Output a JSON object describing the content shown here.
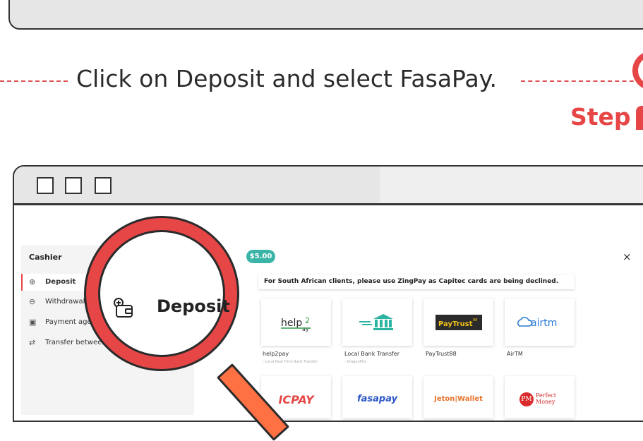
{
  "instruction": {
    "text": "Click on Deposit and select FasaPay.",
    "step_label": "Step"
  },
  "cashier": {
    "title": "Cashier",
    "menu": [
      {
        "label": "Deposit",
        "icon": "deposit-icon",
        "active": true
      },
      {
        "label": "Withdrawal",
        "icon": "withdrawal-icon",
        "active": false
      },
      {
        "label": "Payment agen",
        "icon": "payment-agent-icon",
        "active": false
      },
      {
        "label": "Transfer between",
        "icon": "transfer-icon",
        "active": false
      }
    ]
  },
  "header": {
    "balance": "$5.00",
    "close": "×"
  },
  "notice": "For South African clients, please use ZingPay as Capitec cards are being declined.",
  "payment_methods": [
    {
      "name": "help2pay",
      "sub": "- Local Real Time Bank Transfer",
      "logo": "help2pay"
    },
    {
      "name": "Local Bank Transfer",
      "sub": "- DragonPhx",
      "logo": "bank"
    },
    {
      "name": "PayTrust88",
      "sub": "",
      "logo": "paytrust"
    },
    {
      "name": "AirTM",
      "sub": "",
      "logo": "airtm"
    }
  ],
  "payment_methods_row2": [
    {
      "logo_text": "ICPAY"
    },
    {
      "logo_text": "fasapay"
    },
    {
      "logo_text": "Jeton|Wallet"
    },
    {
      "logo_text": "Perfect Money"
    }
  ],
  "magnifier": {
    "label": "Deposit"
  },
  "colors": {
    "accent": "#e64646",
    "balance_pill": "#3bb4a8",
    "handle": "#ff7043"
  }
}
